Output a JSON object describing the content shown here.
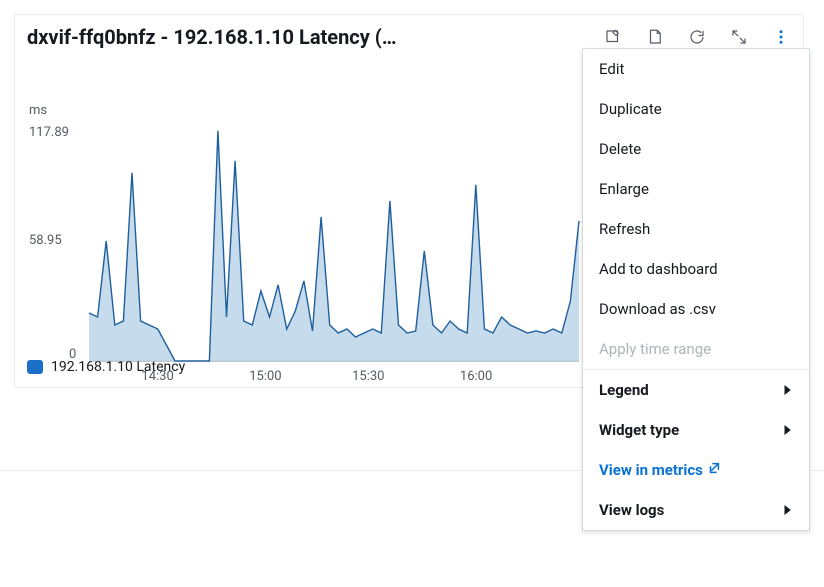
{
  "header": {
    "title": "dxvif-ffq0bnfz - 192.168.1.10 Latency (…"
  },
  "chart_data": {
    "type": "area",
    "title": "dxvif-ffq0bnfz - 192.168.1.10 Latency",
    "ylabel": "ms",
    "xlabel": "",
    "ylim": [
      0,
      117.89
    ],
    "y_ticks": [
      0,
      58.95,
      117.89
    ],
    "x_ticks": [
      "14:30",
      "15:00",
      "15:30",
      "16:00"
    ],
    "series": [
      {
        "name": "192.168.1.10 Latency",
        "color": "#1b6fc7",
        "x": [
          "14:10",
          "14:12",
          "14:14",
          "14:16",
          "14:18",
          "14:20",
          "14:22",
          "14:24",
          "14:26",
          "14:28",
          "14:30",
          "14:40",
          "14:50",
          "15:00",
          "15:05",
          "15:07",
          "15:09",
          "15:11",
          "15:13",
          "15:15",
          "15:17",
          "15:19",
          "15:21",
          "15:23",
          "15:25",
          "15:27",
          "15:29",
          "15:31",
          "15:33",
          "15:35",
          "15:37",
          "15:39",
          "15:41",
          "15:43",
          "15:45",
          "15:47",
          "15:49",
          "15:51",
          "15:53",
          "15:55",
          "15:57",
          "15:59",
          "16:01",
          "16:03",
          "16:05",
          "16:07",
          "16:09",
          "16:11",
          "16:13",
          "16:15",
          "16:17",
          "16:19",
          "16:21",
          "16:23",
          "16:25",
          "16:27",
          "16:29",
          "16:31"
        ],
        "values": [
          24,
          22,
          60,
          18,
          20,
          94,
          20,
          18,
          16,
          8,
          0,
          0,
          0,
          0,
          0,
          115,
          22,
          100,
          20,
          18,
          35,
          22,
          38,
          16,
          25,
          40,
          15,
          72,
          18,
          14,
          16,
          12,
          14,
          16,
          14,
          80,
          18,
          14,
          15,
          55,
          18,
          14,
          20,
          16,
          14,
          88,
          16,
          14,
          22,
          18,
          16,
          14,
          15,
          14,
          16,
          14,
          30,
          70
        ]
      }
    ]
  },
  "legend": {
    "label": "192.168.1.10 Latency"
  },
  "menu": {
    "edit": "Edit",
    "duplicate": "Duplicate",
    "delete": "Delete",
    "enlarge": "Enlarge",
    "refresh": "Refresh",
    "add_to_dashboard": "Add to dashboard",
    "download_csv": "Download as .csv",
    "apply_time_range": "Apply time range",
    "legend": "Legend",
    "widget_type": "Widget type",
    "view_in_metrics": "View in metrics",
    "view_logs": "View logs"
  }
}
